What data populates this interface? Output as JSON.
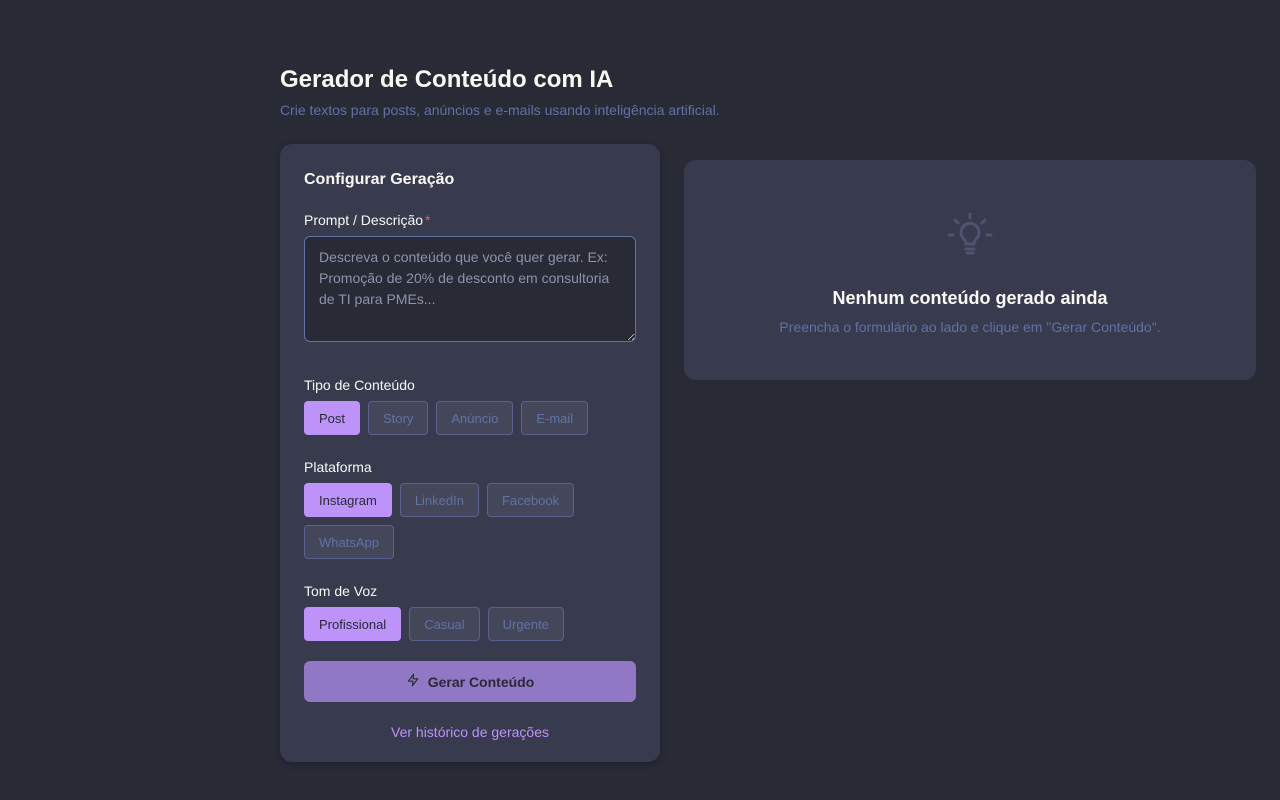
{
  "header": {
    "title": "Gerador de Conteúdo com IA",
    "subtitle": "Crie textos para posts, anúncios e e-mails usando inteligência artificial."
  },
  "config": {
    "title": "Configurar Geração",
    "prompt": {
      "label": "Prompt / Descrição",
      "required_mark": "*",
      "value": "",
      "placeholder": "Descreva o conteúdo que você quer gerar. Ex: Promoção de 20% de desconto em consultoria de TI para PMEs..."
    },
    "content_type": {
      "label": "Tipo de Conteúdo",
      "options": [
        "Post",
        "Story",
        "Anúncio",
        "E-mail"
      ],
      "selected": "Post"
    },
    "platform": {
      "label": "Plataforma",
      "options": [
        "Instagram",
        "LinkedIn",
        "Facebook",
        "WhatsApp"
      ],
      "selected": "Instagram"
    },
    "tone": {
      "label": "Tom de Voz",
      "options": [
        "Profissional",
        "Casual",
        "Urgente"
      ],
      "selected": "Profissional"
    },
    "generate_label": "Gerar Conteúdo",
    "generate_icon": "lightning-icon",
    "history_link": "Ver histórico de gerações"
  },
  "empty_state": {
    "icon": "lightbulb-icon",
    "title": "Nenhum conteúdo gerado ainda",
    "subtitle": "Preencha o formulário ao lado e clique em \"Gerar Conteúdo\"."
  },
  "colors": {
    "background": "#282a36",
    "card": "#383a4e",
    "accent": "#bd93f9",
    "muted": "#6272a4",
    "required": "#ff5555"
  }
}
